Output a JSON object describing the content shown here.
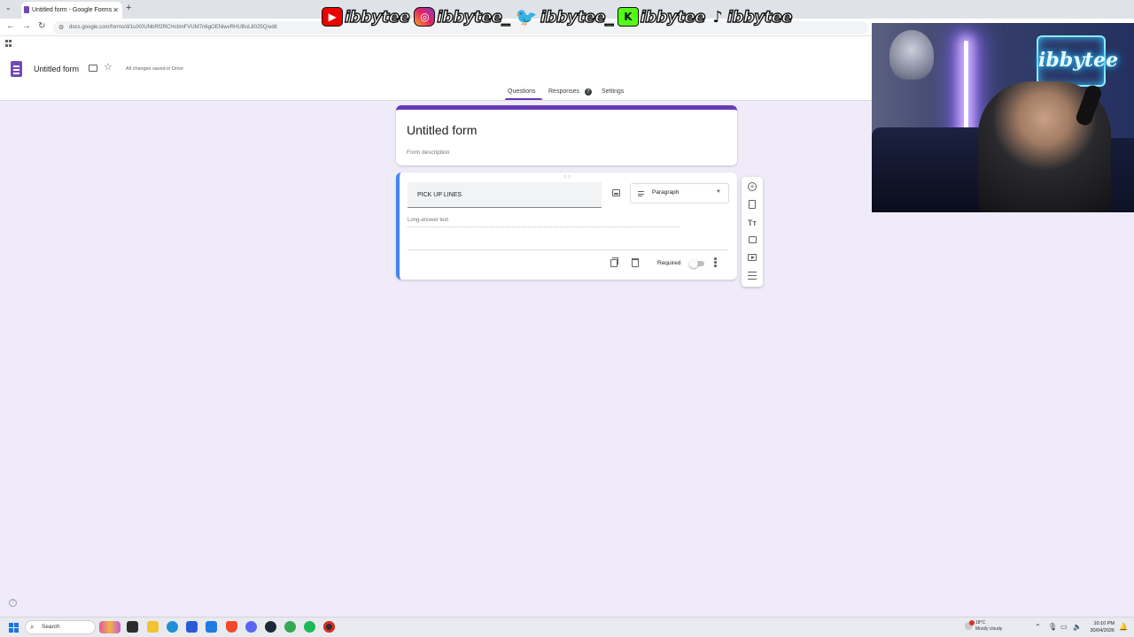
{
  "browser": {
    "tab_title": "Untitled form - Google Forms",
    "url": "docs.google.com/forms/d/1uIX0UNbRf2RCHcIimFVUM7n6gOENiwvRHUBoL8025Q/edit"
  },
  "overlay": {
    "youtube": "ibbytee",
    "instagram": "ibbytee_",
    "twitter": "ibbytee_",
    "kick": "ibbytee",
    "tiktok": "ibbytee"
  },
  "webcam": {
    "neon_sign": "ibbytee"
  },
  "forms_header": {
    "title": "Untitled form",
    "save_status": "All changes saved in Drive",
    "tabs": [
      {
        "label": "Questions",
        "active": true
      },
      {
        "label": "Responses",
        "badge": "7"
      },
      {
        "label": "Settings"
      }
    ]
  },
  "form": {
    "title": "Untitled form",
    "description_placeholder": "Form description",
    "question": {
      "title": "PICK UP LINES",
      "type": "Paragraph",
      "answer_hint": "Long-answer text",
      "required_label": "Required",
      "required": false
    }
  },
  "taskbar": {
    "search_label": "Search",
    "weather_temp": "18°C",
    "weather_desc": "Mostly cloudy",
    "time": "10:10 PM",
    "date": "30/04/2026"
  },
  "colors": {
    "accent": "#673ab7",
    "active_question": "#4285f4",
    "background": "#f0ebf8"
  }
}
